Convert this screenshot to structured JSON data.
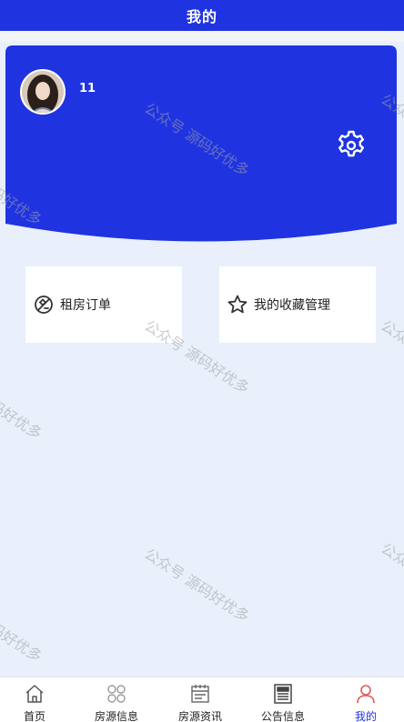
{
  "header": {
    "title": "我的"
  },
  "profile": {
    "username": "11"
  },
  "menu": {
    "items": [
      {
        "label": "租房订单",
        "icon": "ban-tag-icon"
      },
      {
        "label": "我的收藏管理",
        "icon": "star-icon"
      }
    ]
  },
  "watermark": {
    "text": "公众号 源码好优多"
  },
  "tabbar": {
    "items": [
      {
        "label": "首页",
        "icon": "home-icon"
      },
      {
        "label": "房源信息",
        "icon": "grid-icon"
      },
      {
        "label": "房源资讯",
        "icon": "calendar-icon"
      },
      {
        "label": "公告信息",
        "icon": "newspaper-icon"
      },
      {
        "label": "我的",
        "icon": "user-icon"
      }
    ],
    "active_index": 4
  },
  "colors": {
    "primary": "#1f34e0",
    "background": "#e9f0fb",
    "card": "#ffffff",
    "text": "#222222"
  }
}
